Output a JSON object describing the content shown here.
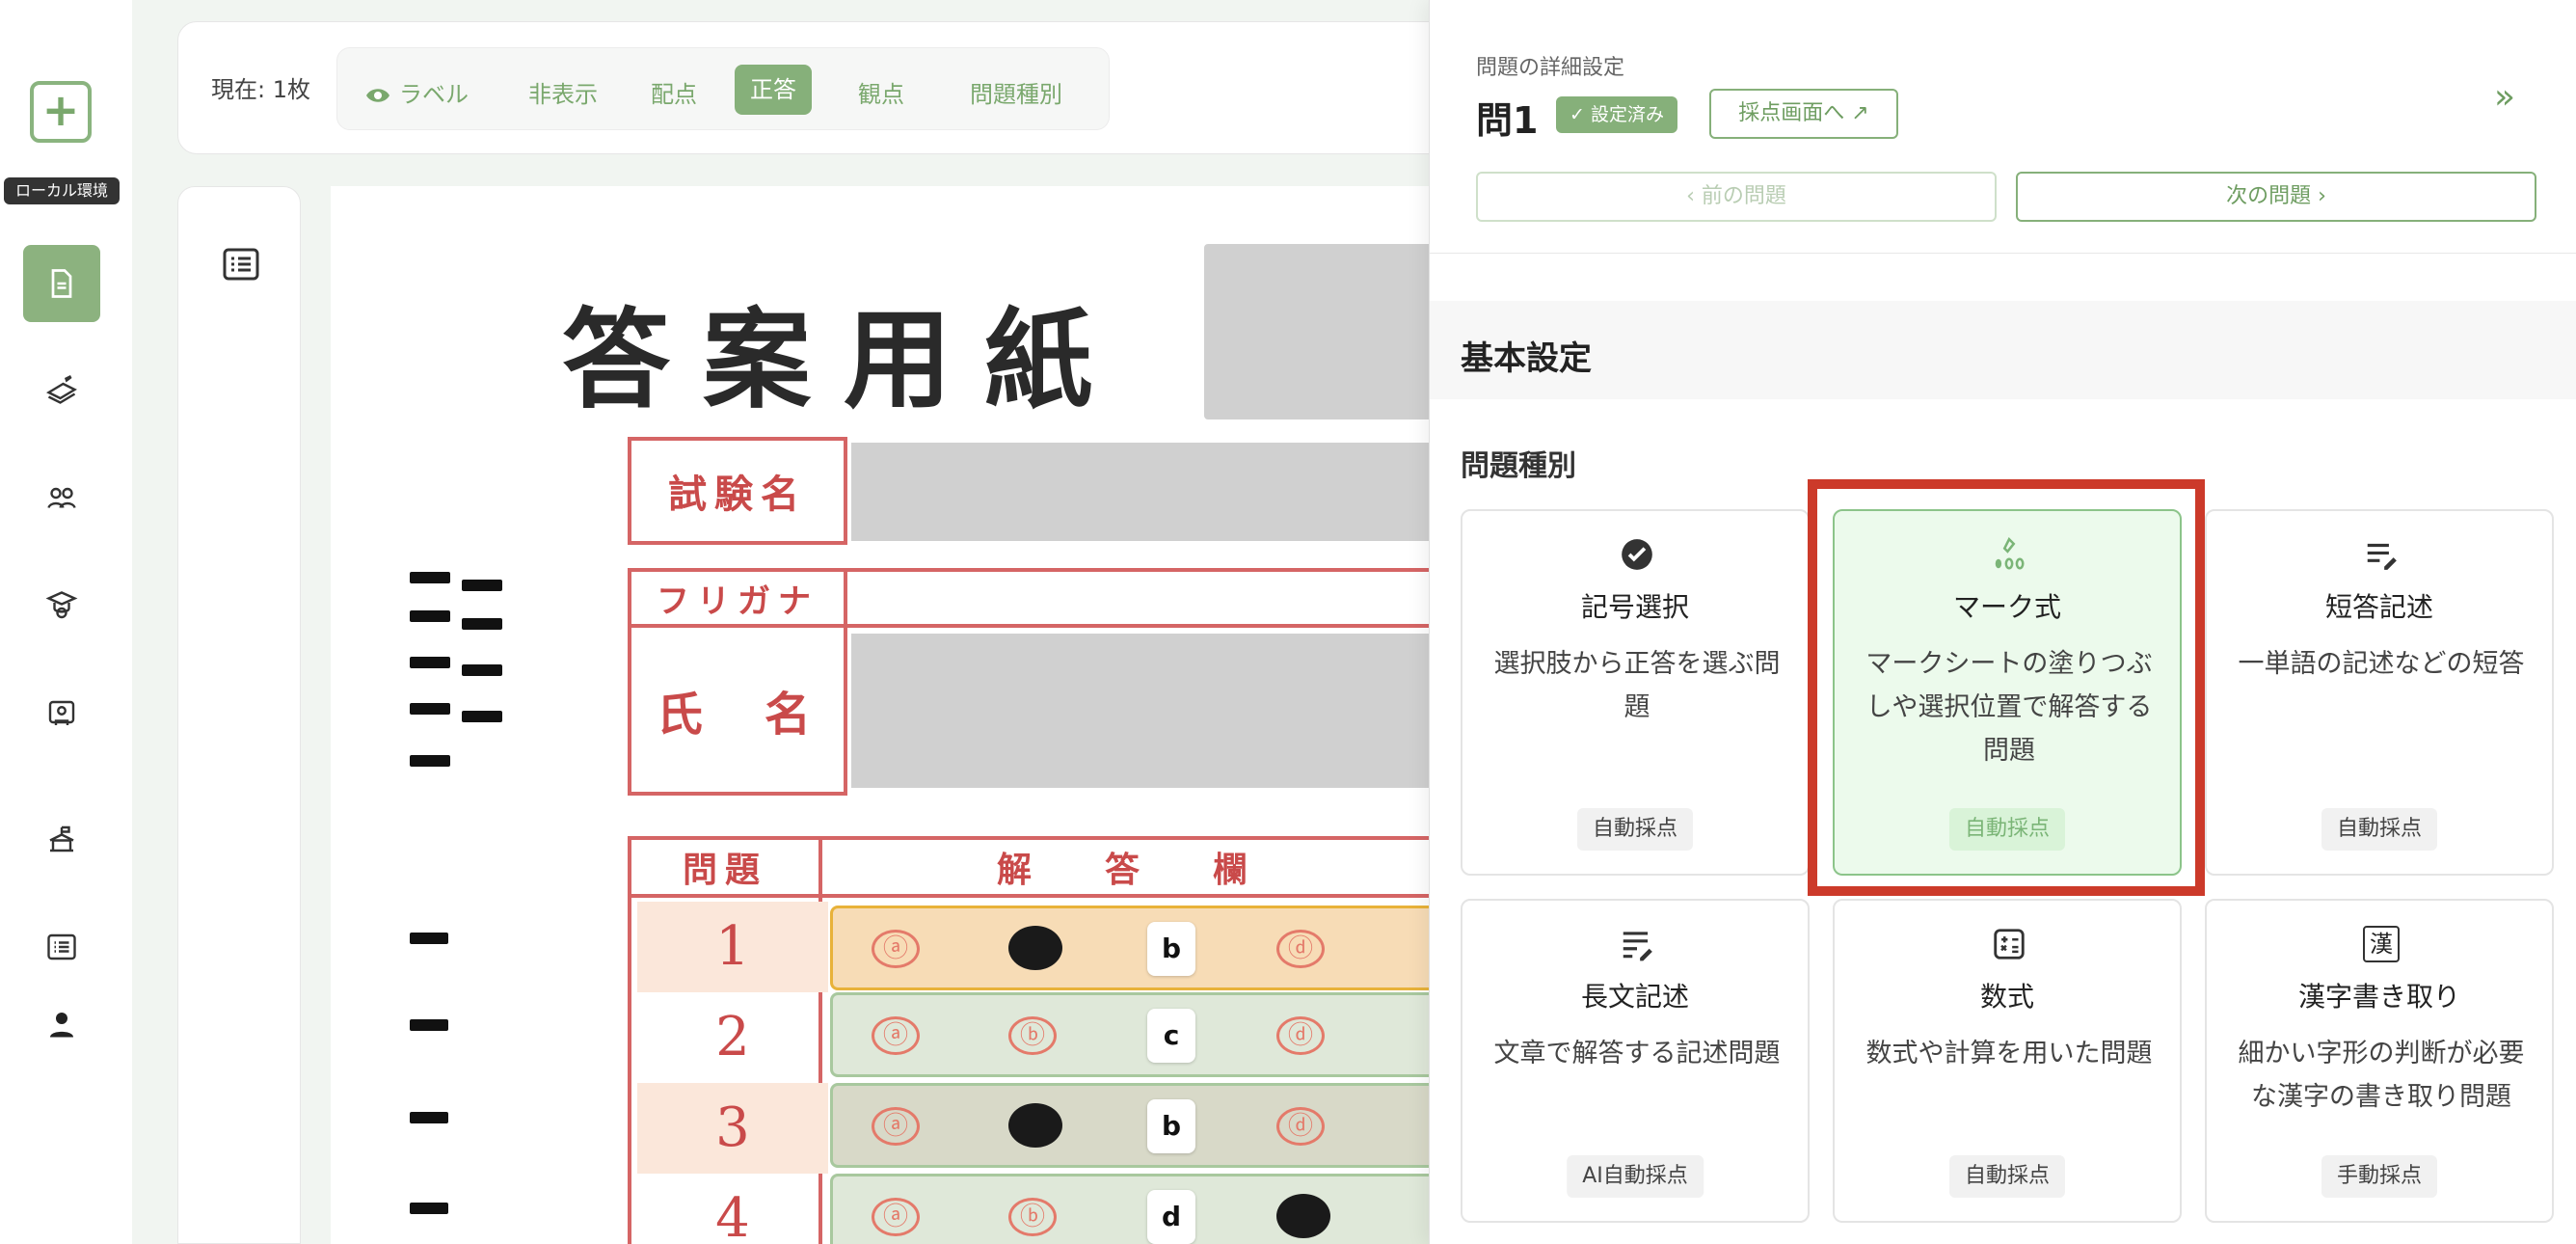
{
  "rail": {
    "add_label": "+",
    "env_label": "ローカル環境",
    "items": [
      "document",
      "pen",
      "group",
      "student",
      "classroom",
      "school",
      "list",
      "person"
    ]
  },
  "toolbar": {
    "status": "現在: 1枚",
    "tabs": [
      {
        "label": "ラベル",
        "active": false
      },
      {
        "label": "非表示",
        "active": false
      },
      {
        "label": "配点",
        "active": false
      },
      {
        "label": "正答",
        "active": true
      },
      {
        "label": "観点",
        "active": false
      },
      {
        "label": "問題種別",
        "active": false
      }
    ]
  },
  "sheet": {
    "title": "答案用紙",
    "exam_label": "試験名",
    "furigana_label": "フリガナ",
    "name_label": "氏　名",
    "grid_header": {
      "question": "問題",
      "answer": "解　答　欄"
    },
    "rows": [
      {
        "num": "1",
        "pick": "b"
      },
      {
        "num": "2",
        "pick": "c"
      },
      {
        "num": "3",
        "pick": "b"
      },
      {
        "num": "4",
        "pick": "d"
      }
    ],
    "bubble_a": "ⓐ",
    "bubble_b": "ⓑ",
    "bubble_d": "ⓓ"
  },
  "panel": {
    "subtitle": "問題の詳細設定",
    "question": "問1",
    "status_badge": "✓ 設定済み",
    "grading_button": "採点画面へ ↗",
    "collapse": "»",
    "prev_button": "‹  前の問題",
    "next_button": "次の問題  ›",
    "section_title": "基本設定",
    "field_title": "問題種別",
    "cards": [
      {
        "name": "記号選択",
        "desc": "選択肢から正答を選ぶ問題",
        "tag": "自動採点",
        "icon": "check-circle-icon",
        "selected": false
      },
      {
        "name": "マーク式",
        "desc": "マークシートの塗りつぶしや選択位置で解答する問題",
        "tag": "自動採点",
        "icon": "mark-sheet-icon",
        "selected": true
      },
      {
        "name": "短答記述",
        "desc": "一単語の記述などの短答",
        "tag": "自動採点",
        "icon": "short-answer-icon",
        "selected": false
      },
      {
        "name": "長文記述",
        "desc": "文章で解答する記述問題",
        "tag": "AI自動採点",
        "icon": "long-text-icon",
        "selected": false
      },
      {
        "name": "数式",
        "desc": "数式や計算を用いた問題",
        "tag": "自動採点",
        "icon": "calculator-icon",
        "selected": false
      },
      {
        "name": "漢字書き取り",
        "desc": "細かい字形の判断が必要な漢字の書き取り問題",
        "tag": "手動採点",
        "icon": "kanji-icon",
        "selected": false
      }
    ],
    "kanji_icon_char": "漢"
  }
}
